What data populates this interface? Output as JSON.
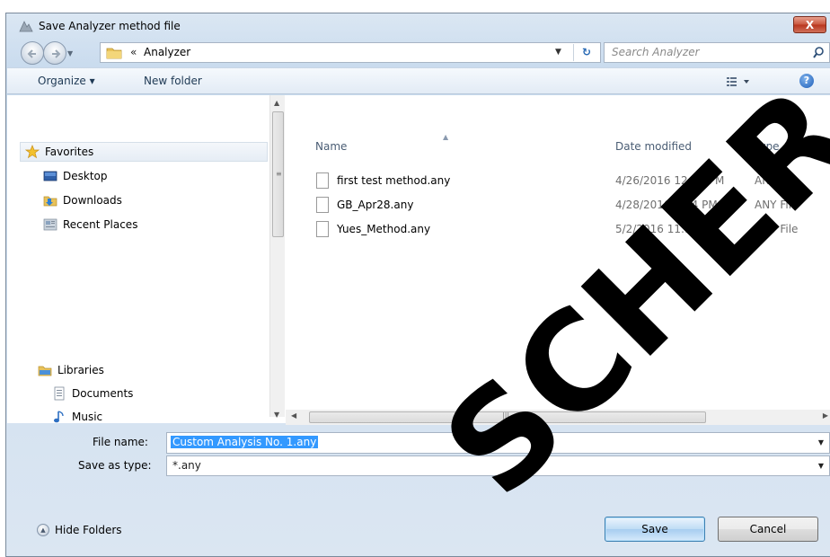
{
  "window": {
    "title": "Save Analyzer method file",
    "close_glyph": "X"
  },
  "address_bar": {
    "chevron": "«",
    "path": "Analyzer",
    "refresh_glyph": "↻"
  },
  "search": {
    "placeholder": "Search Analyzer"
  },
  "toolbar": {
    "organize_label": "Organize ▾",
    "new_folder_label": "New folder",
    "help_glyph": "?"
  },
  "nav_pane": {
    "favorites": {
      "label": "Favorites",
      "items": [
        {
          "label": "Desktop"
        },
        {
          "label": "Downloads"
        },
        {
          "label": "Recent Places"
        }
      ]
    },
    "libraries": {
      "label": "Libraries",
      "items": [
        {
          "label": "Documents"
        },
        {
          "label": "Music"
        }
      ]
    }
  },
  "file_list": {
    "columns": [
      "Name",
      "Date modified",
      "Type"
    ],
    "files": [
      {
        "name": "first test method.any",
        "date": "4/26/2016 12:57 PM",
        "type": "ANY File"
      },
      {
        "name": "GB_Apr28.any",
        "date": "4/28/2016 1:24 PM",
        "type": "ANY File"
      },
      {
        "name": "Yues_Method.any",
        "date": "5/2/2016 11:18 PM",
        "type": "ANY File"
      }
    ]
  },
  "form": {
    "file_name_label": "File name:",
    "file_name_value": "Custom Analysis No. 1.any",
    "save_type_label": "Save as type:",
    "save_type_value": "*.any"
  },
  "footer": {
    "hide_folders_label": "Hide Folders",
    "save_label": "Save",
    "cancel_label": "Cancel"
  },
  "watermark": {
    "text": "SCHER SA",
    "color": "#000000"
  }
}
